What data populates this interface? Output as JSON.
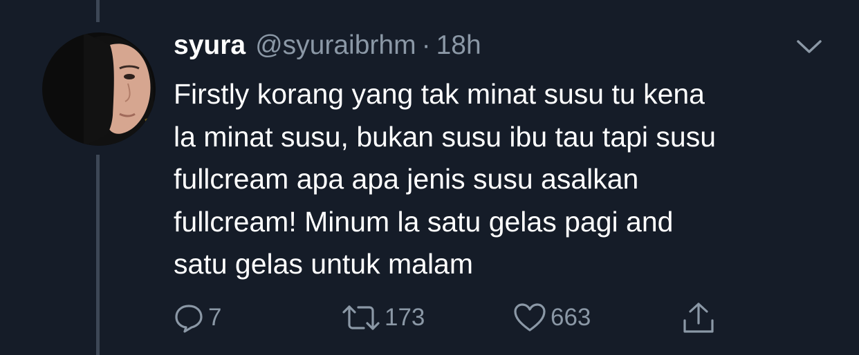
{
  "tweet": {
    "display_name": "syura",
    "handle": "@syuraibrhm",
    "separator": "·",
    "time": "18h",
    "text_lines": [
      "Firstly korang yang tak minat susu tu kena",
      "la minat susu, bukan susu ibu tau tapi susu",
      "fullcream apa apa jenis susu asalkan",
      "fullcream! Minum la satu gelas pagi and",
      "satu gelas untuk malam"
    ]
  },
  "actions": {
    "replies": "7",
    "retweets": "173",
    "likes": "663"
  },
  "icons": {
    "more": "chevron-down-icon",
    "reply": "reply-bubble-icon",
    "retweet": "retweet-icon",
    "like": "heart-icon",
    "share": "share-upload-icon"
  },
  "colors": {
    "background": "#151c28",
    "text": "#ffffff",
    "secondary_text": "#8b98a6",
    "thread_line": "#3d4756"
  }
}
